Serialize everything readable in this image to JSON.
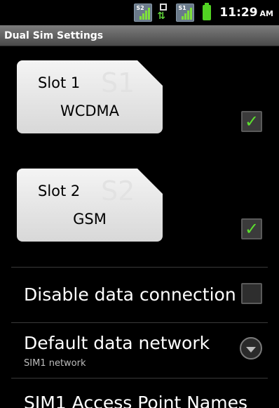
{
  "status_bar": {
    "sim2_tag": "S2",
    "sim1_tag": "S1",
    "time": "11:29",
    "ampm": "AM"
  },
  "title_bar": {
    "title": "Dual Sim Settings"
  },
  "slots": [
    {
      "label": "Slot 1",
      "watermark": "S1",
      "network_type": "WCDMA",
      "enabled": true
    },
    {
      "label": "Slot 2",
      "watermark": "S2",
      "network_type": "GSM",
      "enabled": true
    }
  ],
  "preferences": {
    "disable_data": {
      "title": "Disable data connection",
      "checked": false
    },
    "default_network": {
      "title": "Default data network",
      "summary": "SIM1 network"
    },
    "apn": {
      "title": "SIM1 Access Point Names"
    }
  },
  "colors": {
    "accent_check": "#5ce02e",
    "battery": "#52d323",
    "signal": "#7ee03a"
  }
}
